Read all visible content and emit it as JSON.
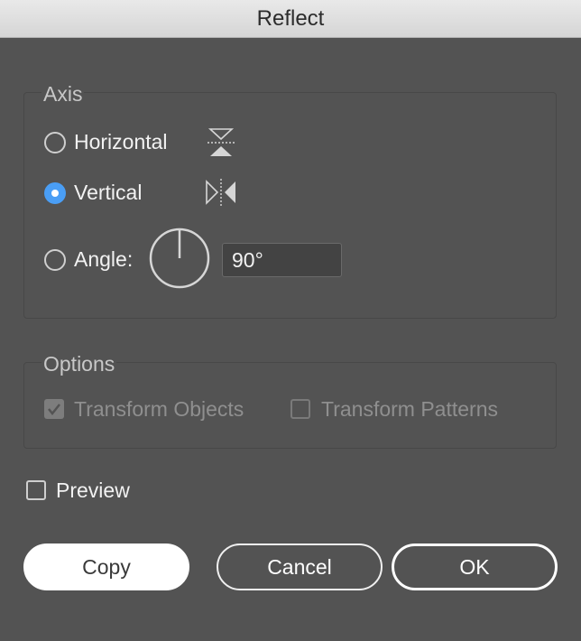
{
  "title": "Reflect",
  "axis": {
    "group_label": "Axis",
    "horizontal_label": "Horizontal",
    "vertical_label": "Vertical",
    "angle_label": "Angle:",
    "angle_value": "90°",
    "selected": "Vertical"
  },
  "options": {
    "group_label": "Options",
    "transform_objects_label": "Transform Objects",
    "transform_objects_checked": true,
    "transform_patterns_label": "Transform Patterns",
    "transform_patterns_checked": false,
    "enabled": false
  },
  "preview": {
    "label": "Preview",
    "checked": false
  },
  "buttons": {
    "copy": "Copy",
    "cancel": "Cancel",
    "ok": "OK"
  },
  "colors": {
    "background": "#535353",
    "radio_selected": "#4a9ef5",
    "text": "#f2f2f2",
    "disabled_text": "#8f8f8f"
  }
}
